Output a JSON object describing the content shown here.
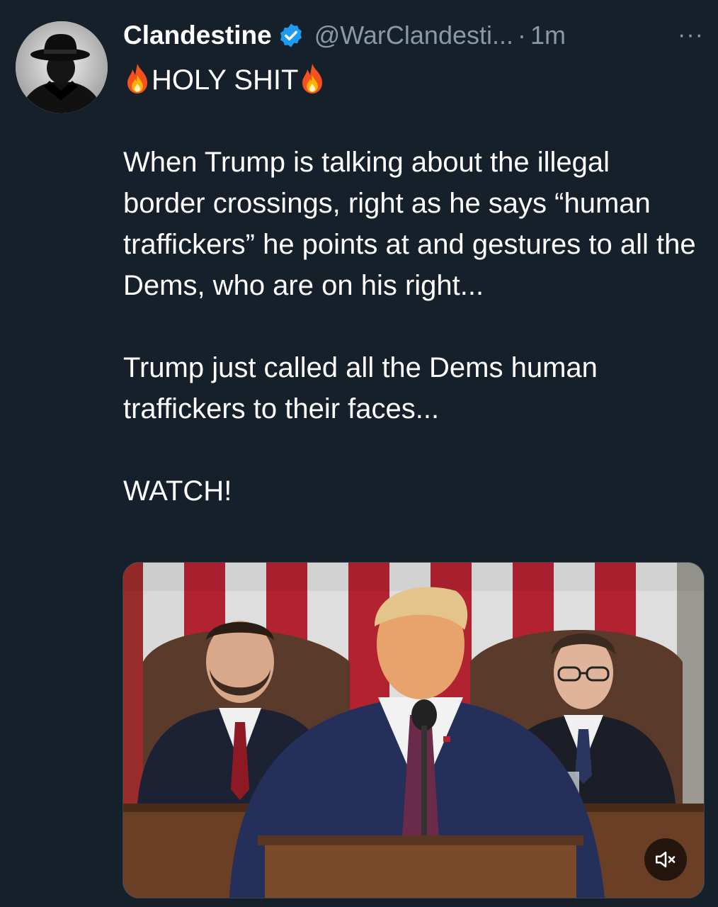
{
  "tweet": {
    "author": {
      "display_name": "Clandestine",
      "handle": "@WarClandesti...",
      "verified": true,
      "avatar_icon": "fedora-silhouette-avatar"
    },
    "separator": "·",
    "timestamp": "1m",
    "more_label": "···",
    "text": {
      "headline": "HOLY SHIT",
      "paragraph_1": "When Trump is talking about the illegal border crossings, right as he says “human traffickers” he points at and gestures to all the Dems, who are on his right...",
      "paragraph_2": "Trump just called all the Dems human traffickers to their faces...",
      "paragraph_3": "WATCH!"
    },
    "media": {
      "type": "video",
      "mute_icon": "speaker-muted-icon"
    }
  },
  "colors": {
    "background": "#15202b",
    "text_primary": "#ffffff",
    "text_secondary": "#8b98a5",
    "verified": "#1d9bf0"
  }
}
